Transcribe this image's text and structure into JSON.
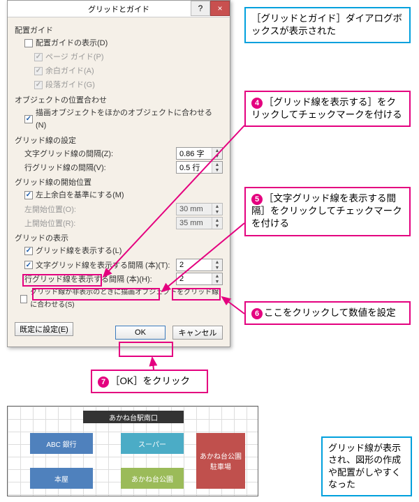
{
  "dialog": {
    "title": "グリッドとガイド",
    "help": "?",
    "close": "×",
    "sections": {
      "alignGuide": "配置ガイド",
      "alignGuideShow": "配置ガイドの表示(D)",
      "pageGuide": "ページ ガイド(P)",
      "marginGuide": "余白ガイド(A)",
      "paraGuide": "段落ガイド(G)",
      "objAlign": "オブジェクトの位置合わせ",
      "snapOthers": "描画オブジェクトをほかのオブジェクトに合わせる(N)",
      "gridSettings": "グリッド線の設定",
      "charGridSpacing": "文字グリッド線の間隔(Z):",
      "charGridVal": "0.86 字",
      "lineGridSpacing": "行グリッド線の間隔(V):",
      "lineGridVal": "0.5 行",
      "gridStart": "グリッド線の開始位置",
      "useMargin": "左上余白を基準にする(M)",
      "leftStart": "左開始位置(O):",
      "leftStartVal": "30 mm",
      "topStart": "上開始位置(R):",
      "topStartVal": "35 mm",
      "gridShow": "グリッドの表示",
      "showGrid": "グリッド線を表示する(L)",
      "charGridShow": "文字グリッド線を表示する間隔 (本)(T):",
      "charGridShowVal": "2",
      "lineGridShow": "行グリッド線を表示する間隔 (本)(H):",
      "lineGridShowVal": "2",
      "snapHidden": "グリッド線が非表示のときに描画オブジェクトをグリッド線に合わせる(S)"
    },
    "buttons": {
      "default": "既定に設定(E)",
      "ok": "OK",
      "cancel": "キャンセル"
    }
  },
  "callouts": {
    "blueTop": "［グリッドとガイド］ダイアログボックスが表示された",
    "c4": "［グリッド線を表示する］をクリックしてチェックマークを付ける",
    "c5": "［文字グリッド線を表示する間隔］をクリックしてチェックマークを付ける",
    "c6": "ここをクリックして数値を設定",
    "c7": "［OK］をクリック",
    "blueBottom": "グリッド線が表示され、図形の作成や配置がしやすくなった"
  },
  "nums": {
    "n4": "4",
    "n5": "5",
    "n6": "6",
    "n7": "7"
  },
  "canvas": {
    "title": "あかね台駅南口",
    "abc": "ABC 銀行",
    "sup": "スーパー",
    "book": "本屋",
    "park": "あかね台公園",
    "parking": "あかね台公園駐車場"
  }
}
